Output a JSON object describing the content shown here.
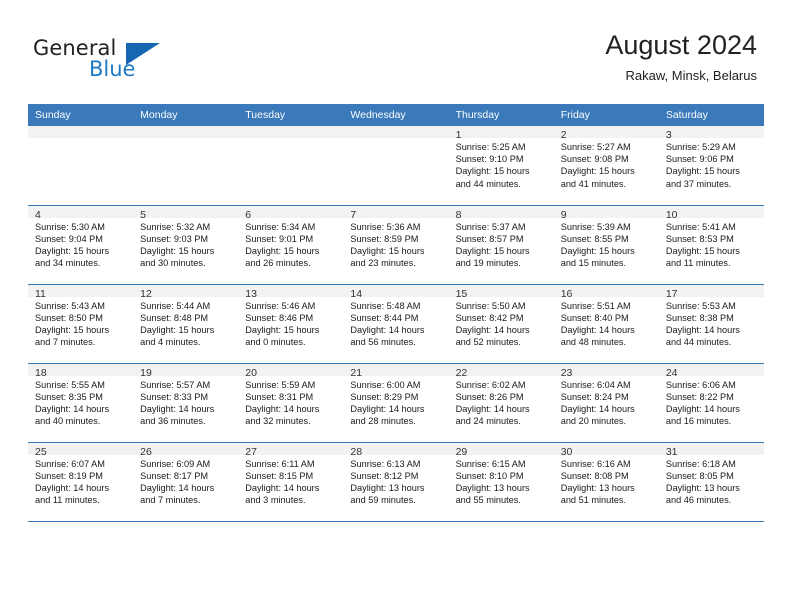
{
  "brand": {
    "name_part1": "General",
    "name_part2": "Blue",
    "flag_icon": "triangle-flag-icon",
    "accent_color": "#2079c3"
  },
  "header": {
    "title": "August 2024",
    "subtitle": "Rakaw, Minsk, Belarus"
  },
  "theme": {
    "header_blue": "#3a79ba",
    "daynum_band": "#f2f2f2",
    "text": "#1a1a1a"
  },
  "calendar": {
    "weekday_headers": [
      "Sunday",
      "Monday",
      "Tuesday",
      "Wednesday",
      "Thursday",
      "Friday",
      "Saturday"
    ],
    "weeks": [
      [
        {
          "day": "",
          "sunrise": "",
          "sunset": "",
          "daylight_line1": "",
          "daylight_line2": ""
        },
        {
          "day": "",
          "sunrise": "",
          "sunset": "",
          "daylight_line1": "",
          "daylight_line2": ""
        },
        {
          "day": "",
          "sunrise": "",
          "sunset": "",
          "daylight_line1": "",
          "daylight_line2": ""
        },
        {
          "day": "",
          "sunrise": "",
          "sunset": "",
          "daylight_line1": "",
          "daylight_line2": ""
        },
        {
          "day": "1",
          "sunrise": "Sunrise: 5:25 AM",
          "sunset": "Sunset: 9:10 PM",
          "daylight_line1": "Daylight: 15 hours",
          "daylight_line2": "and 44 minutes."
        },
        {
          "day": "2",
          "sunrise": "Sunrise: 5:27 AM",
          "sunset": "Sunset: 9:08 PM",
          "daylight_line1": "Daylight: 15 hours",
          "daylight_line2": "and 41 minutes."
        },
        {
          "day": "3",
          "sunrise": "Sunrise: 5:29 AM",
          "sunset": "Sunset: 9:06 PM",
          "daylight_line1": "Daylight: 15 hours",
          "daylight_line2": "and 37 minutes."
        }
      ],
      [
        {
          "day": "4",
          "sunrise": "Sunrise: 5:30 AM",
          "sunset": "Sunset: 9:04 PM",
          "daylight_line1": "Daylight: 15 hours",
          "daylight_line2": "and 34 minutes."
        },
        {
          "day": "5",
          "sunrise": "Sunrise: 5:32 AM",
          "sunset": "Sunset: 9:03 PM",
          "daylight_line1": "Daylight: 15 hours",
          "daylight_line2": "and 30 minutes."
        },
        {
          "day": "6",
          "sunrise": "Sunrise: 5:34 AM",
          "sunset": "Sunset: 9:01 PM",
          "daylight_line1": "Daylight: 15 hours",
          "daylight_line2": "and 26 minutes."
        },
        {
          "day": "7",
          "sunrise": "Sunrise: 5:36 AM",
          "sunset": "Sunset: 8:59 PM",
          "daylight_line1": "Daylight: 15 hours",
          "daylight_line2": "and 23 minutes."
        },
        {
          "day": "8",
          "sunrise": "Sunrise: 5:37 AM",
          "sunset": "Sunset: 8:57 PM",
          "daylight_line1": "Daylight: 15 hours",
          "daylight_line2": "and 19 minutes."
        },
        {
          "day": "9",
          "sunrise": "Sunrise: 5:39 AM",
          "sunset": "Sunset: 8:55 PM",
          "daylight_line1": "Daylight: 15 hours",
          "daylight_line2": "and 15 minutes."
        },
        {
          "day": "10",
          "sunrise": "Sunrise: 5:41 AM",
          "sunset": "Sunset: 8:53 PM",
          "daylight_line1": "Daylight: 15 hours",
          "daylight_line2": "and 11 minutes."
        }
      ],
      [
        {
          "day": "11",
          "sunrise": "Sunrise: 5:43 AM",
          "sunset": "Sunset: 8:50 PM",
          "daylight_line1": "Daylight: 15 hours",
          "daylight_line2": "and 7 minutes."
        },
        {
          "day": "12",
          "sunrise": "Sunrise: 5:44 AM",
          "sunset": "Sunset: 8:48 PM",
          "daylight_line1": "Daylight: 15 hours",
          "daylight_line2": "and 4 minutes."
        },
        {
          "day": "13",
          "sunrise": "Sunrise: 5:46 AM",
          "sunset": "Sunset: 8:46 PM",
          "daylight_line1": "Daylight: 15 hours",
          "daylight_line2": "and 0 minutes."
        },
        {
          "day": "14",
          "sunrise": "Sunrise: 5:48 AM",
          "sunset": "Sunset: 8:44 PM",
          "daylight_line1": "Daylight: 14 hours",
          "daylight_line2": "and 56 minutes."
        },
        {
          "day": "15",
          "sunrise": "Sunrise: 5:50 AM",
          "sunset": "Sunset: 8:42 PM",
          "daylight_line1": "Daylight: 14 hours",
          "daylight_line2": "and 52 minutes."
        },
        {
          "day": "16",
          "sunrise": "Sunrise: 5:51 AM",
          "sunset": "Sunset: 8:40 PM",
          "daylight_line1": "Daylight: 14 hours",
          "daylight_line2": "and 48 minutes."
        },
        {
          "day": "17",
          "sunrise": "Sunrise: 5:53 AM",
          "sunset": "Sunset: 8:38 PM",
          "daylight_line1": "Daylight: 14 hours",
          "daylight_line2": "and 44 minutes."
        }
      ],
      [
        {
          "day": "18",
          "sunrise": "Sunrise: 5:55 AM",
          "sunset": "Sunset: 8:35 PM",
          "daylight_line1": "Daylight: 14 hours",
          "daylight_line2": "and 40 minutes."
        },
        {
          "day": "19",
          "sunrise": "Sunrise: 5:57 AM",
          "sunset": "Sunset: 8:33 PM",
          "daylight_line1": "Daylight: 14 hours",
          "daylight_line2": "and 36 minutes."
        },
        {
          "day": "20",
          "sunrise": "Sunrise: 5:59 AM",
          "sunset": "Sunset: 8:31 PM",
          "daylight_line1": "Daylight: 14 hours",
          "daylight_line2": "and 32 minutes."
        },
        {
          "day": "21",
          "sunrise": "Sunrise: 6:00 AM",
          "sunset": "Sunset: 8:29 PM",
          "daylight_line1": "Daylight: 14 hours",
          "daylight_line2": "and 28 minutes."
        },
        {
          "day": "22",
          "sunrise": "Sunrise: 6:02 AM",
          "sunset": "Sunset: 8:26 PM",
          "daylight_line1": "Daylight: 14 hours",
          "daylight_line2": "and 24 minutes."
        },
        {
          "day": "23",
          "sunrise": "Sunrise: 6:04 AM",
          "sunset": "Sunset: 8:24 PM",
          "daylight_line1": "Daylight: 14 hours",
          "daylight_line2": "and 20 minutes."
        },
        {
          "day": "24",
          "sunrise": "Sunrise: 6:06 AM",
          "sunset": "Sunset: 8:22 PM",
          "daylight_line1": "Daylight: 14 hours",
          "daylight_line2": "and 16 minutes."
        }
      ],
      [
        {
          "day": "25",
          "sunrise": "Sunrise: 6:07 AM",
          "sunset": "Sunset: 8:19 PM",
          "daylight_line1": "Daylight: 14 hours",
          "daylight_line2": "and 11 minutes."
        },
        {
          "day": "26",
          "sunrise": "Sunrise: 6:09 AM",
          "sunset": "Sunset: 8:17 PM",
          "daylight_line1": "Daylight: 14 hours",
          "daylight_line2": "and 7 minutes."
        },
        {
          "day": "27",
          "sunrise": "Sunrise: 6:11 AM",
          "sunset": "Sunset: 8:15 PM",
          "daylight_line1": "Daylight: 14 hours",
          "daylight_line2": "and 3 minutes."
        },
        {
          "day": "28",
          "sunrise": "Sunrise: 6:13 AM",
          "sunset": "Sunset: 8:12 PM",
          "daylight_line1": "Daylight: 13 hours",
          "daylight_line2": "and 59 minutes."
        },
        {
          "day": "29",
          "sunrise": "Sunrise: 6:15 AM",
          "sunset": "Sunset: 8:10 PM",
          "daylight_line1": "Daylight: 13 hours",
          "daylight_line2": "and 55 minutes."
        },
        {
          "day": "30",
          "sunrise": "Sunrise: 6:16 AM",
          "sunset": "Sunset: 8:08 PM",
          "daylight_line1": "Daylight: 13 hours",
          "daylight_line2": "and 51 minutes."
        },
        {
          "day": "31",
          "sunrise": "Sunrise: 6:18 AM",
          "sunset": "Sunset: 8:05 PM",
          "daylight_line1": "Daylight: 13 hours",
          "daylight_line2": "and 46 minutes."
        }
      ]
    ]
  }
}
